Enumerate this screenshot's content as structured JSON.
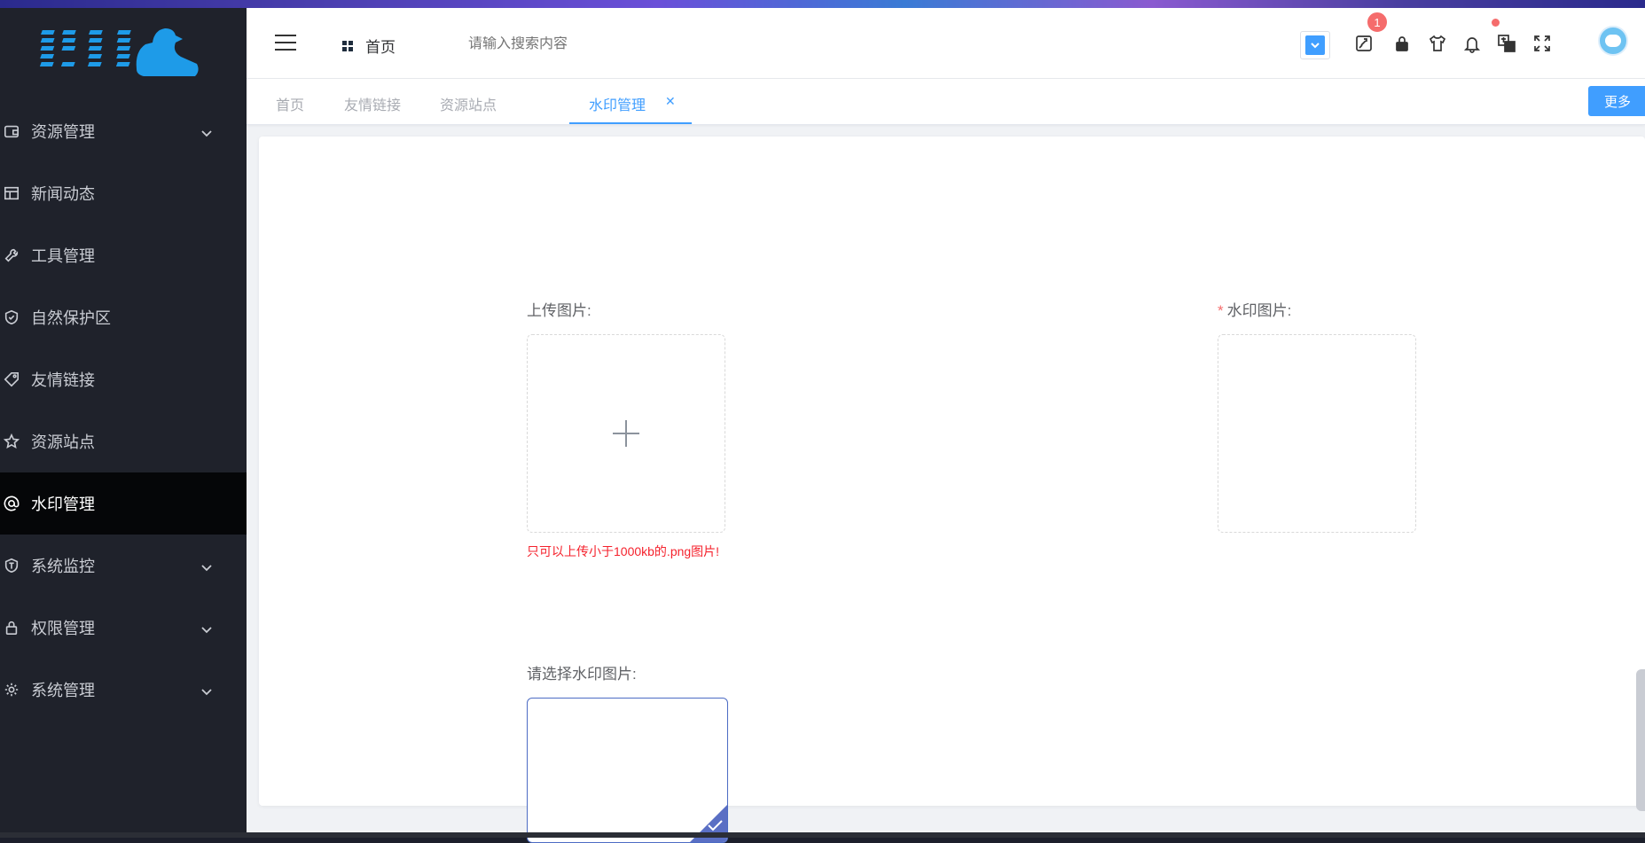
{
  "sidebar": {
    "items": [
      {
        "label": "资源管理",
        "icon": "wallet-icon",
        "has_children": true
      },
      {
        "label": "新闻动态",
        "icon": "table-icon",
        "has_children": false
      },
      {
        "label": "工具管理",
        "icon": "wrench-icon",
        "has_children": false
      },
      {
        "label": "自然保护区",
        "icon": "shield-check-icon",
        "has_children": false
      },
      {
        "label": "友情链接",
        "icon": "tag-icon",
        "has_children": false
      },
      {
        "label": "资源站点",
        "icon": "star-icon",
        "has_children": false
      },
      {
        "label": "水印管理",
        "icon": "at-icon",
        "has_children": false,
        "active": true
      },
      {
        "label": "系统监控",
        "icon": "shield-t-icon",
        "has_children": true
      },
      {
        "label": "权限管理",
        "icon": "lock-icon",
        "has_children": true
      },
      {
        "label": "系统管理",
        "icon": "gear-icon",
        "has_children": true
      }
    ]
  },
  "header": {
    "home_label": "首页",
    "search_placeholder": "请输入搜索内容",
    "notification_badge": "1"
  },
  "tabs": [
    {
      "label": "首页",
      "active": false
    },
    {
      "label": "友情链接",
      "active": false
    },
    {
      "label": "资源站点",
      "active": false
    },
    {
      "label": "水印管理",
      "active": true,
      "closable": true
    }
  ],
  "more_label": "更多",
  "form": {
    "upload_label": "上传图片:",
    "watermark_label": "水印图片:",
    "upload_hint": "只可以上传小于1000kb的.png图片!",
    "choose_label": "请选择水印图片:"
  },
  "colors": {
    "sidebar_bg": "#1f222b",
    "active_item_bg": "#050608",
    "accent": "#409eff",
    "error": "#f5222d",
    "selected_border": "#4d6cc4"
  }
}
